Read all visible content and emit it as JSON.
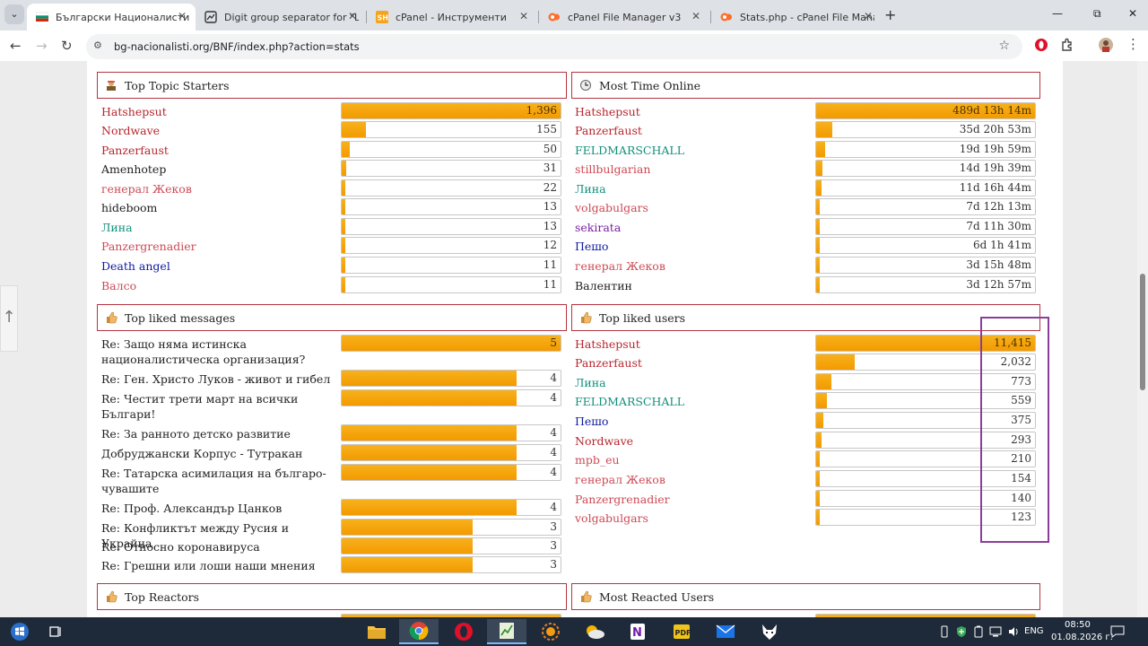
{
  "browser": {
    "tabs": [
      {
        "title": "Български Националистическ",
        "active": true
      },
      {
        "title": "Digit group separator for \"Likes",
        "active": false
      },
      {
        "title": "cPanel - Инструменти",
        "active": false
      },
      {
        "title": "cPanel File Manager v3",
        "active": false
      },
      {
        "title": "Stats.php - cPanel File Manage",
        "active": false
      }
    ],
    "url": "bg-nacionalisti.org/BNF/index.php?action=stats"
  },
  "panels": {
    "top_topic_starters": {
      "title": "Top Topic Starters",
      "rows": [
        {
          "name": "Hatshepsut",
          "value": "1,396",
          "pct": 1.0
        },
        {
          "name": "Nordwave",
          "value": "155",
          "pct": 0.111
        },
        {
          "name": "Panzerfaust",
          "value": "50",
          "pct": 0.036
        },
        {
          "name": "Amenhotep",
          "value": "31",
          "pct": 0.022
        },
        {
          "name": "генерал Жеков",
          "value": "22",
          "pct": 0.016
        },
        {
          "name": "hideboom",
          "value": "13",
          "pct": 0.009
        },
        {
          "name": "Лина",
          "value": "13",
          "pct": 0.009
        },
        {
          "name": "Panzergrenadier",
          "value": "12",
          "pct": 0.009
        },
        {
          "name": "Death angel",
          "value": "11",
          "pct": 0.008
        },
        {
          "name": "Валсо",
          "value": "11",
          "pct": 0.008
        }
      ]
    },
    "most_time_online": {
      "title": "Most Time Online",
      "rows": [
        {
          "name": "Hatshepsut",
          "value": "489d 13h 14m",
          "pct": 1.0
        },
        {
          "name": "Panzerfaust",
          "value": "35d 20h 53m",
          "pct": 0.073
        },
        {
          "name": "FELDMARSCHALL",
          "value": "19d 19h 59m",
          "pct": 0.04
        },
        {
          "name": "stillbulgarian",
          "value": "14d 19h 39m",
          "pct": 0.03
        },
        {
          "name": "Лина",
          "value": "11d 16h 44m",
          "pct": 0.024
        },
        {
          "name": "volgabulgars",
          "value": "7d 12h 13m",
          "pct": 0.015
        },
        {
          "name": "sekirata",
          "value": "7d 11h 30m",
          "pct": 0.015
        },
        {
          "name": "Пешо",
          "value": "6d 1h 41m",
          "pct": 0.012
        },
        {
          "name": "генерал Жеков",
          "value": "3d 15h 48m",
          "pct": 0.007
        },
        {
          "name": "Валентин",
          "value": "3d 12h 57m",
          "pct": 0.007
        }
      ]
    },
    "top_liked_messages": {
      "title": "Top liked messages",
      "rows": [
        {
          "name": "Re: Защо няма истинска националистическа организация?",
          "value": "5",
          "pct": 1.0
        },
        {
          "name": "Re: Ген. Христо Луков - живот и гибел",
          "value": "4",
          "pct": 0.8
        },
        {
          "name": "Re: Честит трети март на всички Българи!",
          "value": "4",
          "pct": 0.8
        },
        {
          "name": "Re: За ранното детско развитие",
          "value": "4",
          "pct": 0.8
        },
        {
          "name": "Добруджански Корпус - Тутракан",
          "value": "4",
          "pct": 0.8
        },
        {
          "name": "Re: Татарска асимилация на българо-чувашите",
          "value": "4",
          "pct": 0.8
        },
        {
          "name": "Re: Проф. Александър Цанков",
          "value": "4",
          "pct": 0.8
        },
        {
          "name": "Re: Конфликтът между Русия и Украйна",
          "value": "3",
          "pct": 0.6
        },
        {
          "name": "Re: Относно коронавируса",
          "value": "3",
          "pct": 0.6
        },
        {
          "name": "Re: Грешни или лоши наши мнения",
          "value": "3",
          "pct": 0.6
        }
      ]
    },
    "top_liked_users": {
      "title": "Top liked users",
      "rows": [
        {
          "name": "Hatshepsut",
          "value": "11,415",
          "pct": 1.0
        },
        {
          "name": "Panzerfaust",
          "value": "2,032",
          "pct": 0.178
        },
        {
          "name": "Лина",
          "value": "773",
          "pct": 0.068
        },
        {
          "name": "FELDMARSCHALL",
          "value": "559",
          "pct": 0.049
        },
        {
          "name": "Пешо",
          "value": "375",
          "pct": 0.033
        },
        {
          "name": "Nordwave",
          "value": "293",
          "pct": 0.026
        },
        {
          "name": "mpb_eu",
          "value": "210",
          "pct": 0.018
        },
        {
          "name": "генерал Жеков",
          "value": "154",
          "pct": 0.013
        },
        {
          "name": "Panzergrenadier",
          "value": "140",
          "pct": 0.012
        },
        {
          "name": "volgabulgars",
          "value": "123",
          "pct": 0.011
        }
      ]
    },
    "top_reactors": {
      "title": "Top Reactors"
    },
    "most_reacted_users": {
      "title": "Most Reacted Users"
    }
  },
  "taskbar": {
    "time": "08:50",
    "date": "01.08.2026 г.",
    "language": "ENG"
  }
}
